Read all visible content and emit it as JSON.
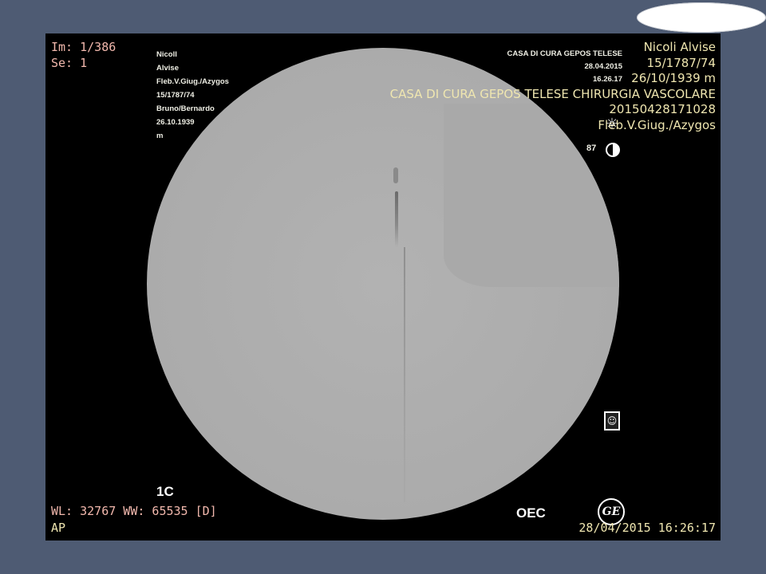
{
  "overlay": {
    "top_left": {
      "image_index": "Im: 1/386",
      "series": "Se: 1"
    },
    "burned_in_left": [
      "Nicoll",
      "Alvise",
      "Fleb.V.Giug./Azygos",
      "15/1787/74",
      "Bruno/Bernardo",
      "26.10.1939",
      "m"
    ],
    "burned_in_right": [
      "CASA DI CURA GEPOS TELESE",
      "28.04.2015",
      "16.26.17"
    ],
    "top_right": [
      "Nicoli Alvise",
      "15/1787/74",
      "26/10/1939 m",
      "CASA DI CURA GEPOS TELESE CHIRURGIA VASCOLARE",
      "20150428171028",
      "Fleb.V.Giug./Azygos"
    ],
    "frame_number": "87",
    "marker_1c": "1C",
    "window_level": "WL: 32767 WW: 65535 [D]",
    "orientation": "AP",
    "oec_label": "OEC",
    "ge_logo_text": "GE",
    "datetime": "28/04/2015 16:26:17"
  },
  "icons": {
    "sun": "sun-icon",
    "half_moon": "half-moon-icon",
    "orientation": "orientation-figure-icon",
    "ge": "ge-logo-icon"
  },
  "colors": {
    "background": "#4e5b73",
    "overlay_pink": "#f2b8ad",
    "overlay_yellow": "#efe6b0"
  }
}
